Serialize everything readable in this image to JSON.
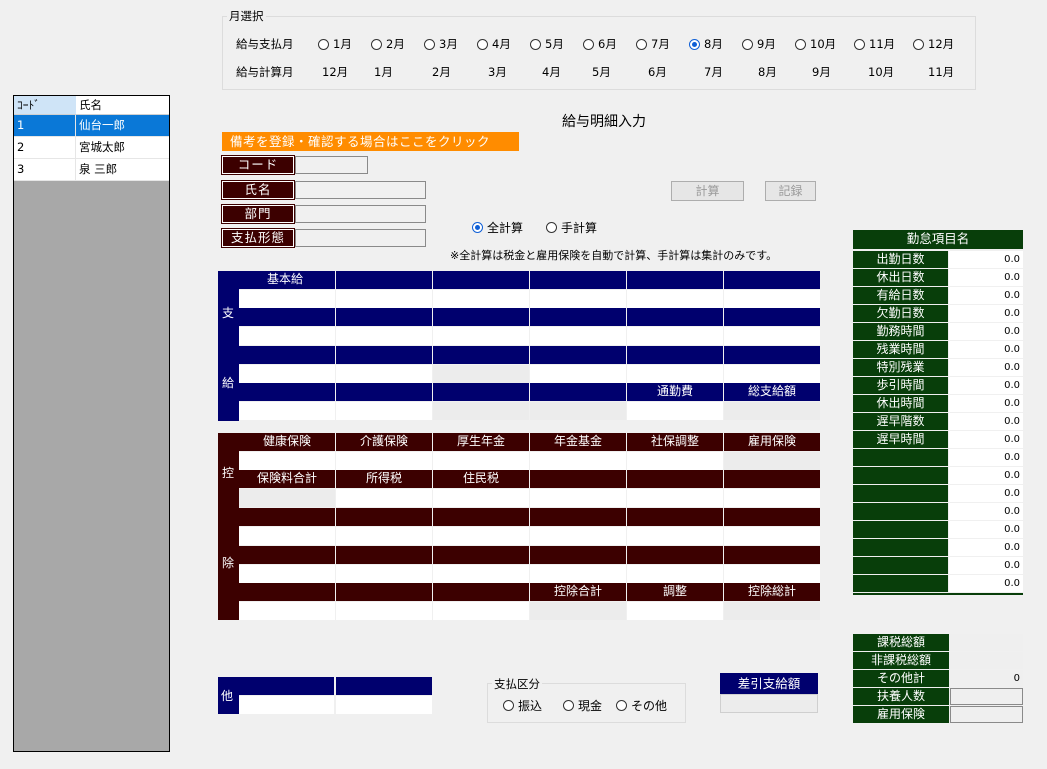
{
  "month_select": {
    "title": "月選択",
    "pay_month_label": "給与支払月",
    "calc_month_label": "給与計算月",
    "pay_months": [
      "1月",
      "2月",
      "3月",
      "4月",
      "5月",
      "6月",
      "7月",
      "8月",
      "9月",
      "10月",
      "11月",
      "12月"
    ],
    "calc_months": [
      "12月",
      "1月",
      "2月",
      "3月",
      "4月",
      "5月",
      "6月",
      "7月",
      "8月",
      "9月",
      "10月",
      "11月"
    ],
    "selected_index": 7
  },
  "employee_list": {
    "headers": {
      "code": "ｺｰﾄﾞ",
      "name": "氏名"
    },
    "rows": [
      {
        "code": "1",
        "name": "仙台一郎"
      },
      {
        "code": "2",
        "name": "宮城太郎"
      },
      {
        "code": "3",
        "name": "泉 三郎"
      }
    ]
  },
  "form": {
    "title": "給与明細入力",
    "notes_button": "備考を登録・確認する場合はここをクリック",
    "code_label": "コード",
    "name_label": "氏名",
    "dept_label": "部門",
    "paytype_label": "支払形態",
    "calc_button": "計算",
    "save_button": "記録",
    "full_calc": "全計算",
    "manual_calc": "手計算",
    "calc_note": "※全計算は税金と雇用保険を自動で計算、手計算は集計のみです。"
  },
  "payment": {
    "side_top": "支",
    "side_bottom": "給",
    "basic_salary": "基本給",
    "commute": "通勤費",
    "total_pay": "総支給額"
  },
  "deduction": {
    "side_top": "控",
    "side_bottom": "除",
    "row1": [
      "健康保険",
      "介護保険",
      "厚生年金",
      "年金基金",
      "社保調整",
      "雇用保険"
    ],
    "row2": [
      "保険料合計",
      "所得税",
      "住民税"
    ],
    "deduction_total": "控除合計",
    "adjustment": "調整",
    "deduction_grand_total": "控除総計"
  },
  "other": {
    "side": "他"
  },
  "payment_type": {
    "title": "支払区分",
    "options": [
      "振込",
      "現金",
      "その他"
    ]
  },
  "net_pay": {
    "label": "差引支給額"
  },
  "attendance": {
    "header": "勤怠項目名",
    "items": [
      {
        "label": "出勤日数",
        "value": "0.0"
      },
      {
        "label": "休出日数",
        "value": "0.0"
      },
      {
        "label": "有給日数",
        "value": "0.0"
      },
      {
        "label": "欠勤日数",
        "value": "0.0"
      },
      {
        "label": "勤務時間",
        "value": "0.0"
      },
      {
        "label": "残業時間",
        "value": "0.0"
      },
      {
        "label": "特別残業",
        "value": "0.0"
      },
      {
        "label": "歩引時間",
        "value": "0.0"
      },
      {
        "label": "休出時間",
        "value": "0.0"
      },
      {
        "label": "遅早階数",
        "value": "0.0"
      },
      {
        "label": "遅早時間",
        "value": "0.0"
      },
      {
        "label": "",
        "value": "0.0"
      },
      {
        "label": "",
        "value": "0.0"
      },
      {
        "label": "",
        "value": "0.0"
      },
      {
        "label": "",
        "value": "0.0"
      },
      {
        "label": "",
        "value": "0.0"
      },
      {
        "label": "",
        "value": "0.0"
      },
      {
        "label": "",
        "value": "0.0"
      },
      {
        "label": "",
        "value": "0.0"
      }
    ]
  },
  "tax_summary": {
    "items": [
      {
        "label": "課税総額",
        "value": ""
      },
      {
        "label": "非課税総額",
        "value": ""
      },
      {
        "label": "その他計",
        "value": "0"
      },
      {
        "label": "扶養人数",
        "value": ""
      },
      {
        "label": "雇用保険",
        "value": ""
      }
    ]
  },
  "colors": {
    "navy": "#00006e",
    "maroon": "#3c0000",
    "green": "#083e0a",
    "orange": "#ff8c00",
    "selected": "#0a78d7"
  }
}
